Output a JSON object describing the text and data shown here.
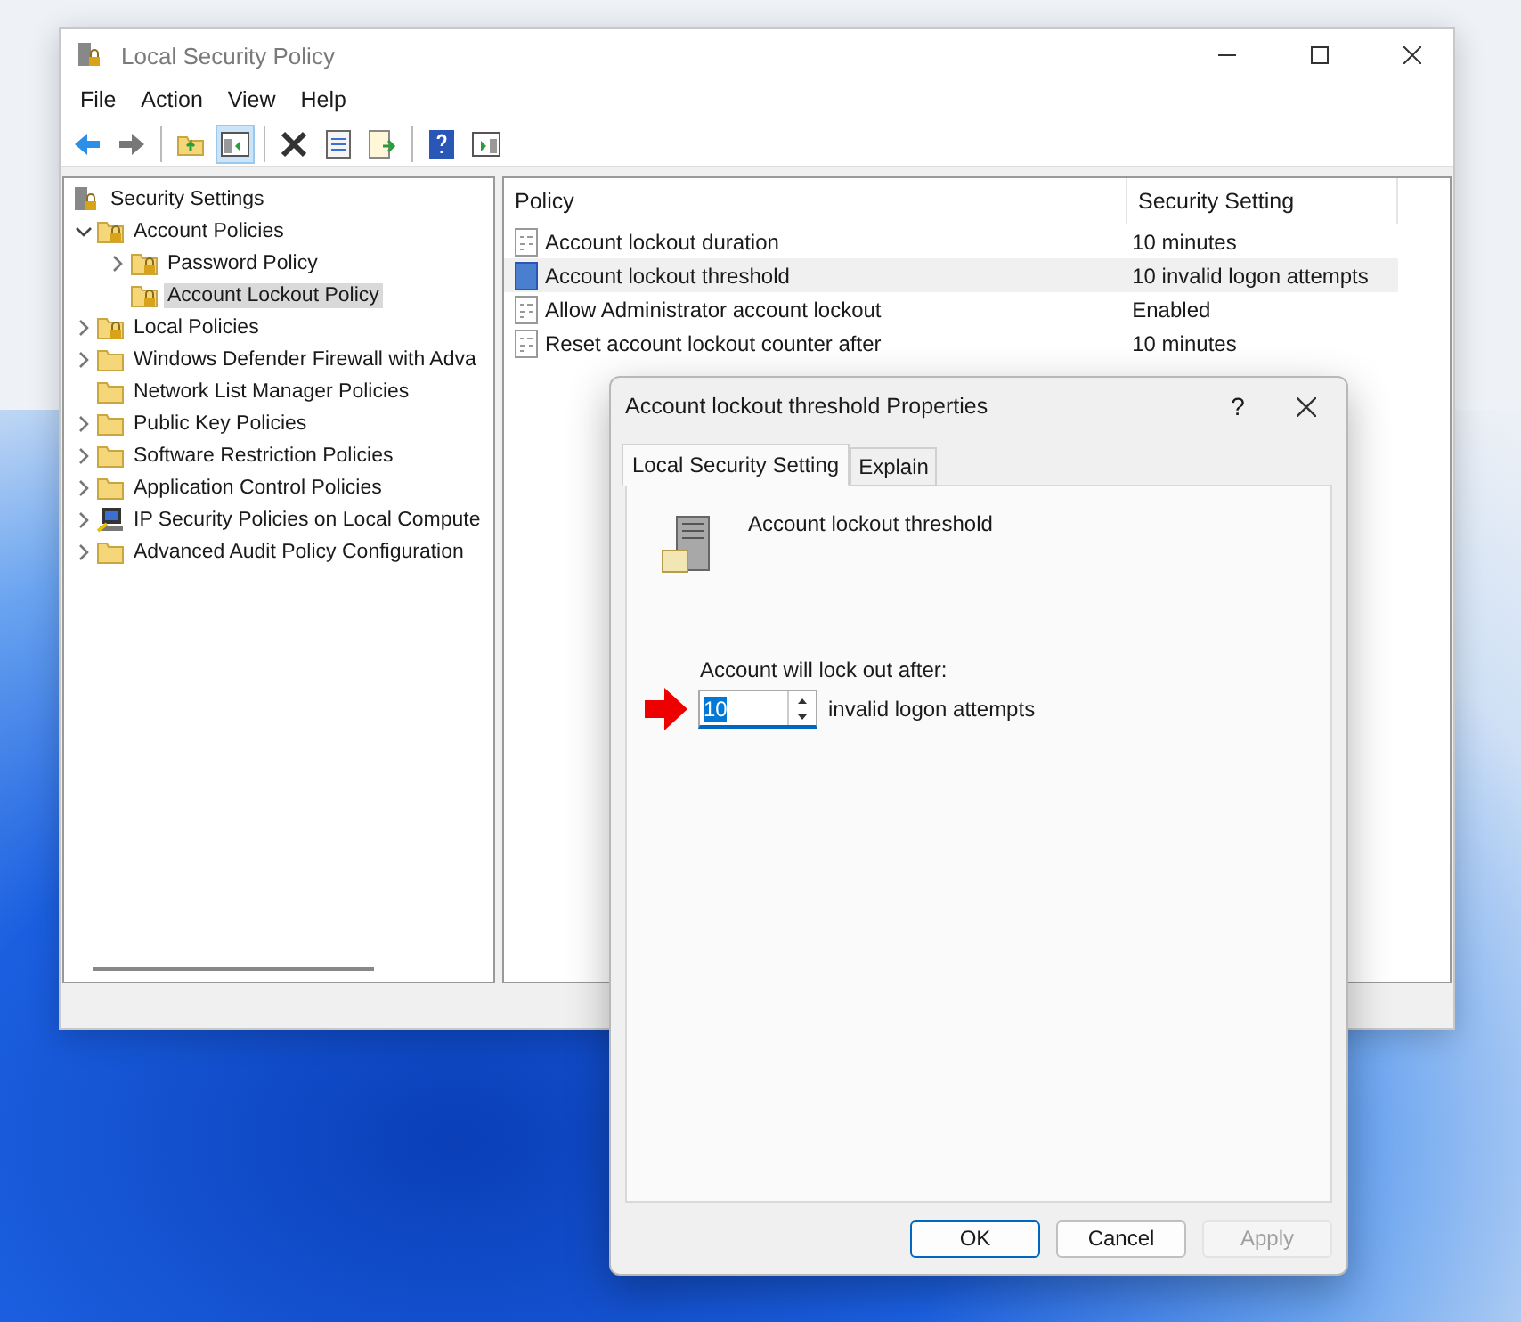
{
  "window": {
    "title": "Local Security Policy"
  },
  "menu": [
    "File",
    "Action",
    "View",
    "Help"
  ],
  "toolbar": [
    {
      "kind": "back"
    },
    {
      "kind": "forward"
    },
    {
      "kind": "sep"
    },
    {
      "kind": "up"
    },
    {
      "kind": "tree",
      "pressed": true
    },
    {
      "kind": "sep"
    },
    {
      "kind": "delete"
    },
    {
      "kind": "properties"
    },
    {
      "kind": "export"
    },
    {
      "kind": "sep"
    },
    {
      "kind": "help"
    },
    {
      "kind": "view"
    }
  ],
  "tree": [
    {
      "label": "Security Settings",
      "kind": "root",
      "selected": false,
      "children": [
        {
          "label": "Account Policies",
          "kind": "lock",
          "selected": false,
          "expanded": true,
          "children": [
            {
              "label": "Password Policy",
              "kind": "lock",
              "selected": false,
              "expanded": false
            },
            {
              "label": "Account Lockout Policy",
              "kind": "lock",
              "selected": true
            }
          ]
        },
        {
          "label": "Local Policies",
          "kind": "lock",
          "selected": false,
          "expanded": false
        },
        {
          "label": "Windows Defender Firewall with Adva",
          "kind": "folder",
          "selected": false,
          "expanded": false
        },
        {
          "label": "Network List Manager Policies",
          "kind": "folder",
          "selected": false
        },
        {
          "label": "Public Key Policies",
          "kind": "folder",
          "selected": false,
          "expanded": false
        },
        {
          "label": "Software Restriction Policies",
          "kind": "folder",
          "selected": false,
          "expanded": false
        },
        {
          "label": "Application Control Policies",
          "kind": "folder",
          "selected": false,
          "expanded": false
        },
        {
          "label": "IP Security Policies on Local Compute",
          "kind": "computer",
          "selected": false,
          "expanded": false
        },
        {
          "label": "Advanced Audit Policy Configuration",
          "kind": "folder",
          "selected": false,
          "expanded": false
        }
      ]
    }
  ],
  "table": {
    "columns": [
      "Policy",
      "Security Setting"
    ],
    "rows": [
      {
        "policy": "Account lockout duration",
        "setting": "10 minutes",
        "selected": false
      },
      {
        "policy": "Account lockout threshold",
        "setting": "10 invalid logon attempts",
        "selected": true
      },
      {
        "policy": "Allow Administrator account lockout",
        "setting": "Enabled",
        "selected": false
      },
      {
        "policy": "Reset account lockout counter after",
        "setting": "10 minutes",
        "selected": false
      }
    ]
  },
  "dialog": {
    "title": "Account lockout threshold Properties",
    "help": "?",
    "tabs": [
      {
        "label": "Local Security Setting",
        "selected": true
      },
      {
        "label": "Explain",
        "selected": false
      }
    ],
    "policy_name": "Account lockout threshold",
    "field_label": "Account will lock out after:",
    "value": "10",
    "value_selected": true,
    "suffix": "invalid logon attempts",
    "buttons": [
      {
        "label": "OK",
        "default": true,
        "disabled": false
      },
      {
        "label": "Cancel",
        "default": false,
        "disabled": false
      },
      {
        "label": "Apply",
        "default": false,
        "disabled": true
      }
    ]
  }
}
